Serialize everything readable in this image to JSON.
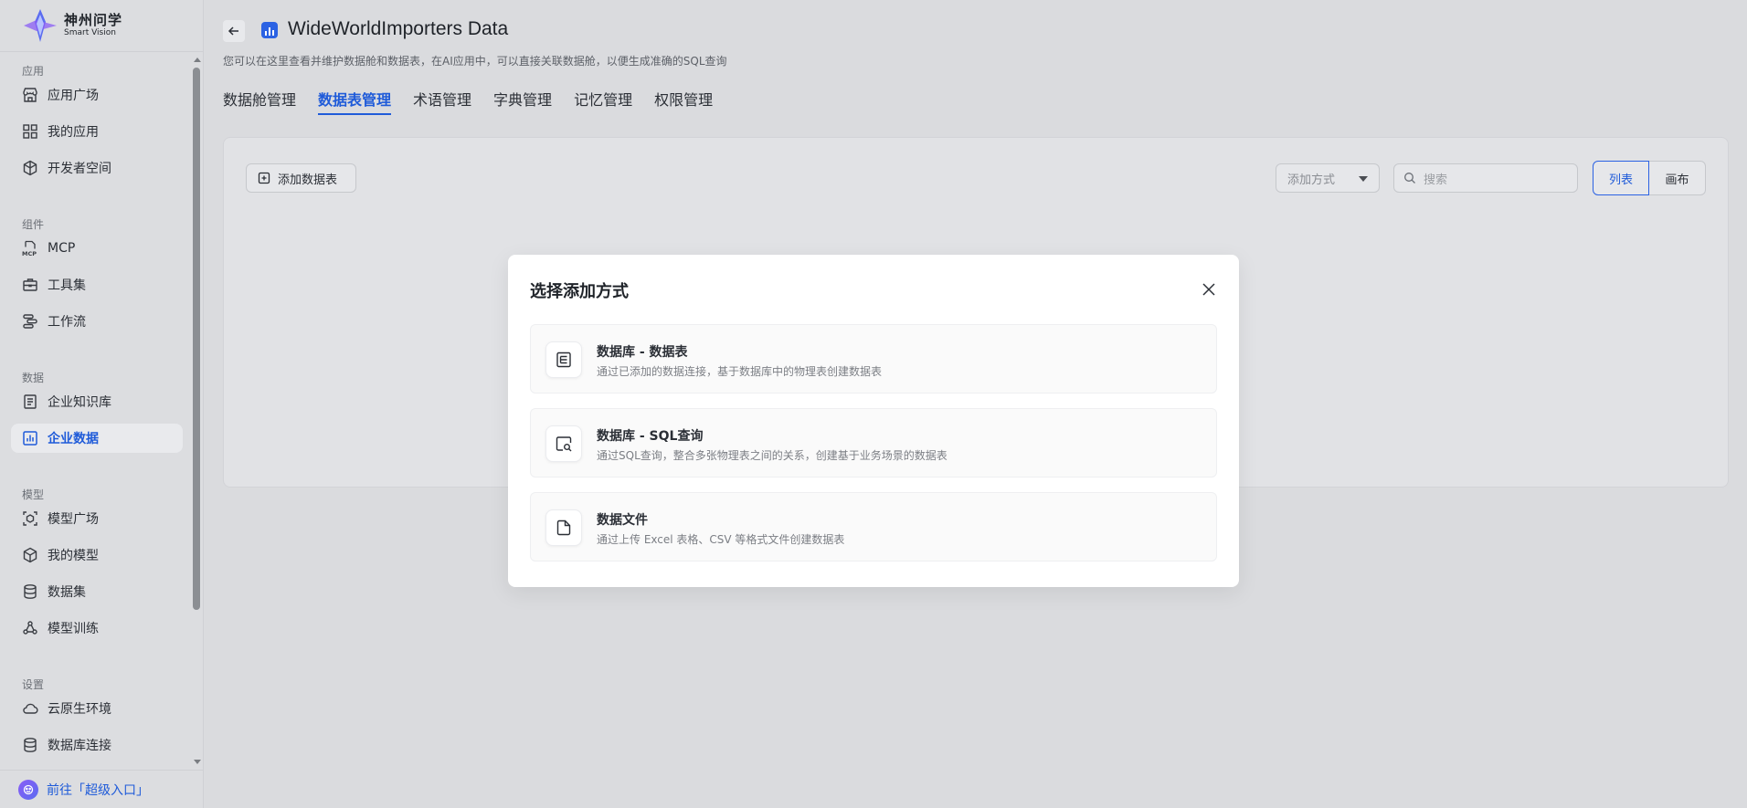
{
  "brand": {
    "name": "神州问学",
    "sub": "Smart Vision"
  },
  "sidebar": {
    "sections": [
      {
        "title": "应用",
        "items": [
          {
            "label": "应用广场",
            "icon": "store-icon"
          },
          {
            "label": "我的应用",
            "icon": "grid-icon"
          },
          {
            "label": "开发者空间",
            "icon": "cube-cluster-icon"
          }
        ]
      },
      {
        "title": "组件",
        "items": [
          {
            "label": "MCP",
            "icon": "mcp-icon"
          },
          {
            "label": "工具集",
            "icon": "toolbox-icon"
          },
          {
            "label": "工作流",
            "icon": "workflow-icon"
          }
        ]
      },
      {
        "title": "数据",
        "items": [
          {
            "label": "企业知识库",
            "icon": "book-icon"
          },
          {
            "label": "企业数据",
            "icon": "bar-chart-icon",
            "active": true
          }
        ]
      },
      {
        "title": "模型",
        "items": [
          {
            "label": "模型广场",
            "icon": "model-square-icon"
          },
          {
            "label": "我的模型",
            "icon": "cube-icon"
          },
          {
            "label": "数据集",
            "icon": "database-icon"
          },
          {
            "label": "模型训练",
            "icon": "training-icon"
          }
        ]
      },
      {
        "title": "设置",
        "items": [
          {
            "label": "云原生环境",
            "icon": "cloud-icon"
          },
          {
            "label": "数据库连接",
            "icon": "db-connection-icon"
          }
        ]
      }
    ],
    "super_entry": "前往「超级入口」"
  },
  "header": {
    "title": "WideWorldImporters Data",
    "description": "您可以在这里查看并维护数据舱和数据表，在AI应用中，可以直接关联数据舱，以便生成准确的SQL查询"
  },
  "tabs": [
    {
      "label": "数据舱管理"
    },
    {
      "label": "数据表管理",
      "active": true
    },
    {
      "label": "术语管理"
    },
    {
      "label": "字典管理"
    },
    {
      "label": "记忆管理"
    },
    {
      "label": "权限管理"
    }
  ],
  "toolbar": {
    "add_table": "添加数据表",
    "add_mode_placeholder": "添加方式",
    "search_placeholder": "搜索",
    "view_list": "列表",
    "view_canvas": "画布"
  },
  "modal": {
    "title": "选择添加方式",
    "options": [
      {
        "title": "数据库 - 数据表",
        "desc": "通过已添加的数据连接，基于数据库中的物理表创建数据表",
        "icon": "table-list-icon"
      },
      {
        "title": "数据库 - SQL查询",
        "desc": "通过SQL查询，整合多张物理表之间的关系，创建基于业务场景的数据表",
        "icon": "sql-search-icon"
      },
      {
        "title": "数据文件",
        "desc": "通过上传 Excel 表格、CSV 等格式文件创建数据表",
        "icon": "file-icon"
      }
    ]
  },
  "colors": {
    "accent": "#1f5bd9",
    "active_bg": "#e9eaed",
    "overlay_bg": "#dadbde"
  }
}
